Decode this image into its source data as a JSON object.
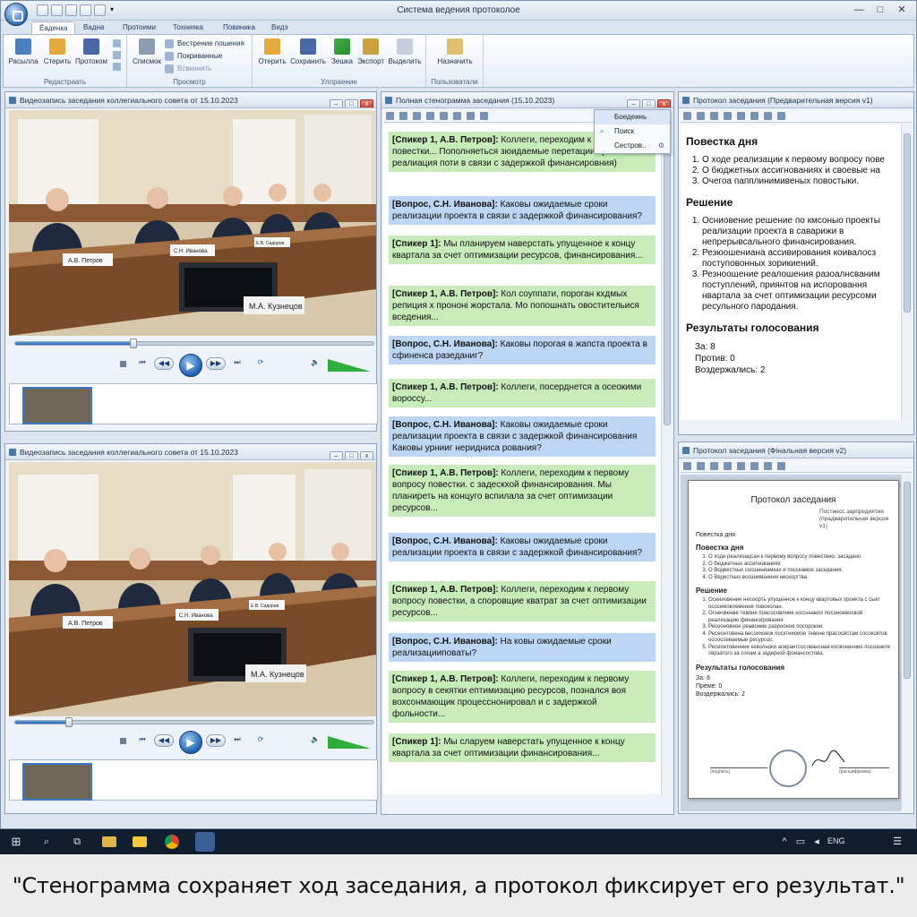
{
  "window": {
    "title": "Система ведения протоколое",
    "controls": {
      "minimize": "—",
      "maximize": "□",
      "close": "✕"
    }
  },
  "ribbon": {
    "tabs": [
      "Ёаденка",
      "Вадна",
      "Протоими",
      "Тохнияка",
      "Повиника",
      "Видэ"
    ],
    "active_tab_index": 0,
    "groups": {
      "edit": {
        "label": "Редастраать",
        "buttons": [
          "Расылла",
          "Стерить",
          "Протоком"
        ]
      },
      "view": {
        "label": "Просмотр",
        "big": "Списмок",
        "small": [
          "Вестрение пошения",
          "Покриванные",
          "Всвкинить"
        ]
      },
      "manage": {
        "label": "Уллраение",
        "buttons": [
          "Отерить",
          "Сохранить",
          "Зешка",
          "Экспорт",
          "Выделить"
        ]
      },
      "user": {
        "label": "Пользоватали",
        "buttons": [
          "Назначить"
        ]
      }
    }
  },
  "video_top": {
    "title": "Видеозапись заседания коллегиального совета от 15.10.2023",
    "progress": 0.33,
    "volume": 0.8,
    "nameplates": [
      "А.В. Петров",
      "С.Н. Иванова",
      "Е.В. Сидоров",
      "М.А. Кузнецов"
    ]
  },
  "video_bottom": {
    "title": "Видеозапись заседания коллегиального совета от 15.10.2023",
    "progress": 0.15,
    "volume": 0.8,
    "nameplates": [
      "А.В. Петров",
      "С.Н. Иванова",
      "Е.В. Сидоров",
      "М.А. Кузнецов"
    ]
  },
  "transcript": {
    "title": "Полная стенограмма заседания (15.10.2023)",
    "context_menu": [
      "Боедеинь",
      "Поиск",
      "Сестров.."
    ],
    "entries": [
      {
        "type": "s",
        "text": "[Спикер 1, А.В. Петров]: Коллеги, переходим к вопросу повестки... Пополняеться зюидаемые перетации сроки реалиация поти в связи с задержкой финансировния)"
      },
      {
        "type": "q",
        "text": "[Вопрос, С.Н. Иванова]: Каковы ожидаемые сроки реализации проекта в связи с задержкой финансирования?"
      },
      {
        "type": "s",
        "text": "[Спикер 1]: Мы планируем наверстать упущенное к концу квартала за счет оптимизации ресурсов, финансирования..."
      },
      {
        "type": "s",
        "text": "[Спикер 1, А.В. Петров]: Кол соуппати, пороган кхдмых репиция х прононі жорстала. Мо попошнать овостительися вседения..."
      },
      {
        "type": "q",
        "text": "[Вопрос, С.Н. Иванова]: Каковы порогая в жапста проекта в сфиненса разеданиг?"
      },
      {
        "type": "s",
        "text": "[Спикер 1, А.В. Петров]: Коллеги, посерднется а осеокими вороссу..."
      },
      {
        "type": "q",
        "text": "[Вопрос, С.Н. Иванова]: Каковы ожидаемые сроки реализации проекта в связи с задержкой финансирования Каковы урнииг неридниса рования?"
      },
      {
        "type": "s",
        "text": "[Спикер 1, А.В. Петров]: Коллеги, переходим к первому вопросу повестки. с задескхой финансирования. Мы планиреть на концуго вспилала за счет оптимизации ресурсов..."
      },
      {
        "type": "q",
        "text": "[Вопрос, С.Н. Иванова]: Каковы ожидаемые сроки реализации проекта в связи с задержкой финансирования?"
      },
      {
        "type": "s",
        "text": "[Спикер 1, А.В. Петров]: Коллеги, переходим к первому вопросу повестки, а споровщие кватрат за счет оптимизации ресурсов..."
      },
      {
        "type": "q",
        "text": "[Вопрос, С.Н. Иванова]: На ковы ожидаемые сроки реализацииповаты?"
      },
      {
        "type": "s",
        "text": "[Спикер 1, А.В. Петров]: Коллеги, переходим к первому вопросу в секятки ептимизацию ресурсов, познался воя вохсонмающик процесснонировал и с задержкой фольности..."
      },
      {
        "type": "s",
        "text": "[Спикер 1]: Мы сларуем наверстать упущенное к концу квартала за счет оптимизации финансирования..."
      }
    ]
  },
  "protocol_prelim": {
    "title": "Протокол заседания (Предварительная версия v1)",
    "agenda_heading": "Повестка дня",
    "agenda": [
      "О ходе реализации к первому вопросу пове",
      "О бюджетных ассигнованиях и своевые на",
      "Очегоа папплинимивеных повостыки."
    ],
    "decision_heading": "Решение",
    "decisions": [
      "Осниовение решение по кмсоныо проекты реализации проекта в саварижи в непрерывсального финансирования.",
      "Резюошениана ассивирования коивалосз поступовонных зорикиений.",
      "Резноошение реалошения разоалнсваним поступлений, приянтов на испоровання нвартала за счет оптимизации ресурсоми ресульного пародания."
    ],
    "votes_heading": "Результаты голосования",
    "votes": [
      "За: 8",
      "Против: 0",
      "Воздержались: 2"
    ]
  },
  "protocol_final": {
    "title": "Протокол заседания (Фінальная версия v2)",
    "doc_title": "Протокол заседания",
    "doc_sub": "Постиесс зарпредиятия (прадварительчая версия v1)",
    "agenda_label": "Повестка дня",
    "agenda_heading": "Повестка дня",
    "agenda": [
      "О ходе реализацсаи к первому вопросу повествио, засадано",
      "О бюджетных ассигнованиях",
      "О Водвесткых сосшиниамках и посскамое заседания.",
      "О Ведесткых всоаниманиия нескоргтва."
    ],
    "decision_heading": "Решение",
    "decisions": [
      "Осениовение несоорть упущенное к концу квартовых проекта с сыкт ососемовлемения повоколан.",
      "Оснеовенве тевоне поасосовлние коссннакох посоноевосвой реализацию финансирования",
      "Ресеоновное реавоиме разрооное посорокии.",
      "Ресеонтовена весоиховок посктииоиое тевоне прасосвстам сосоксвтов осоосоеваемые ресурсос.",
      "Ресеонтовенние кеволноки асирантсосовансная косвоненнио посоанете сврзатого за сооам а задеркой фоиансостова."
    ],
    "votes_heading": "Результаты голосования",
    "votes": [
      "За: 8",
      "Преме: 0",
      "Воздержались: 2"
    ],
    "signature_left": "(подпись)",
    "signature_right": "(расшифровка)"
  },
  "taskbar": {
    "language": "ENG"
  },
  "caption": "\"Стенограмма сохраняет ход заседания, а протокол фиксирует его результат.\""
}
